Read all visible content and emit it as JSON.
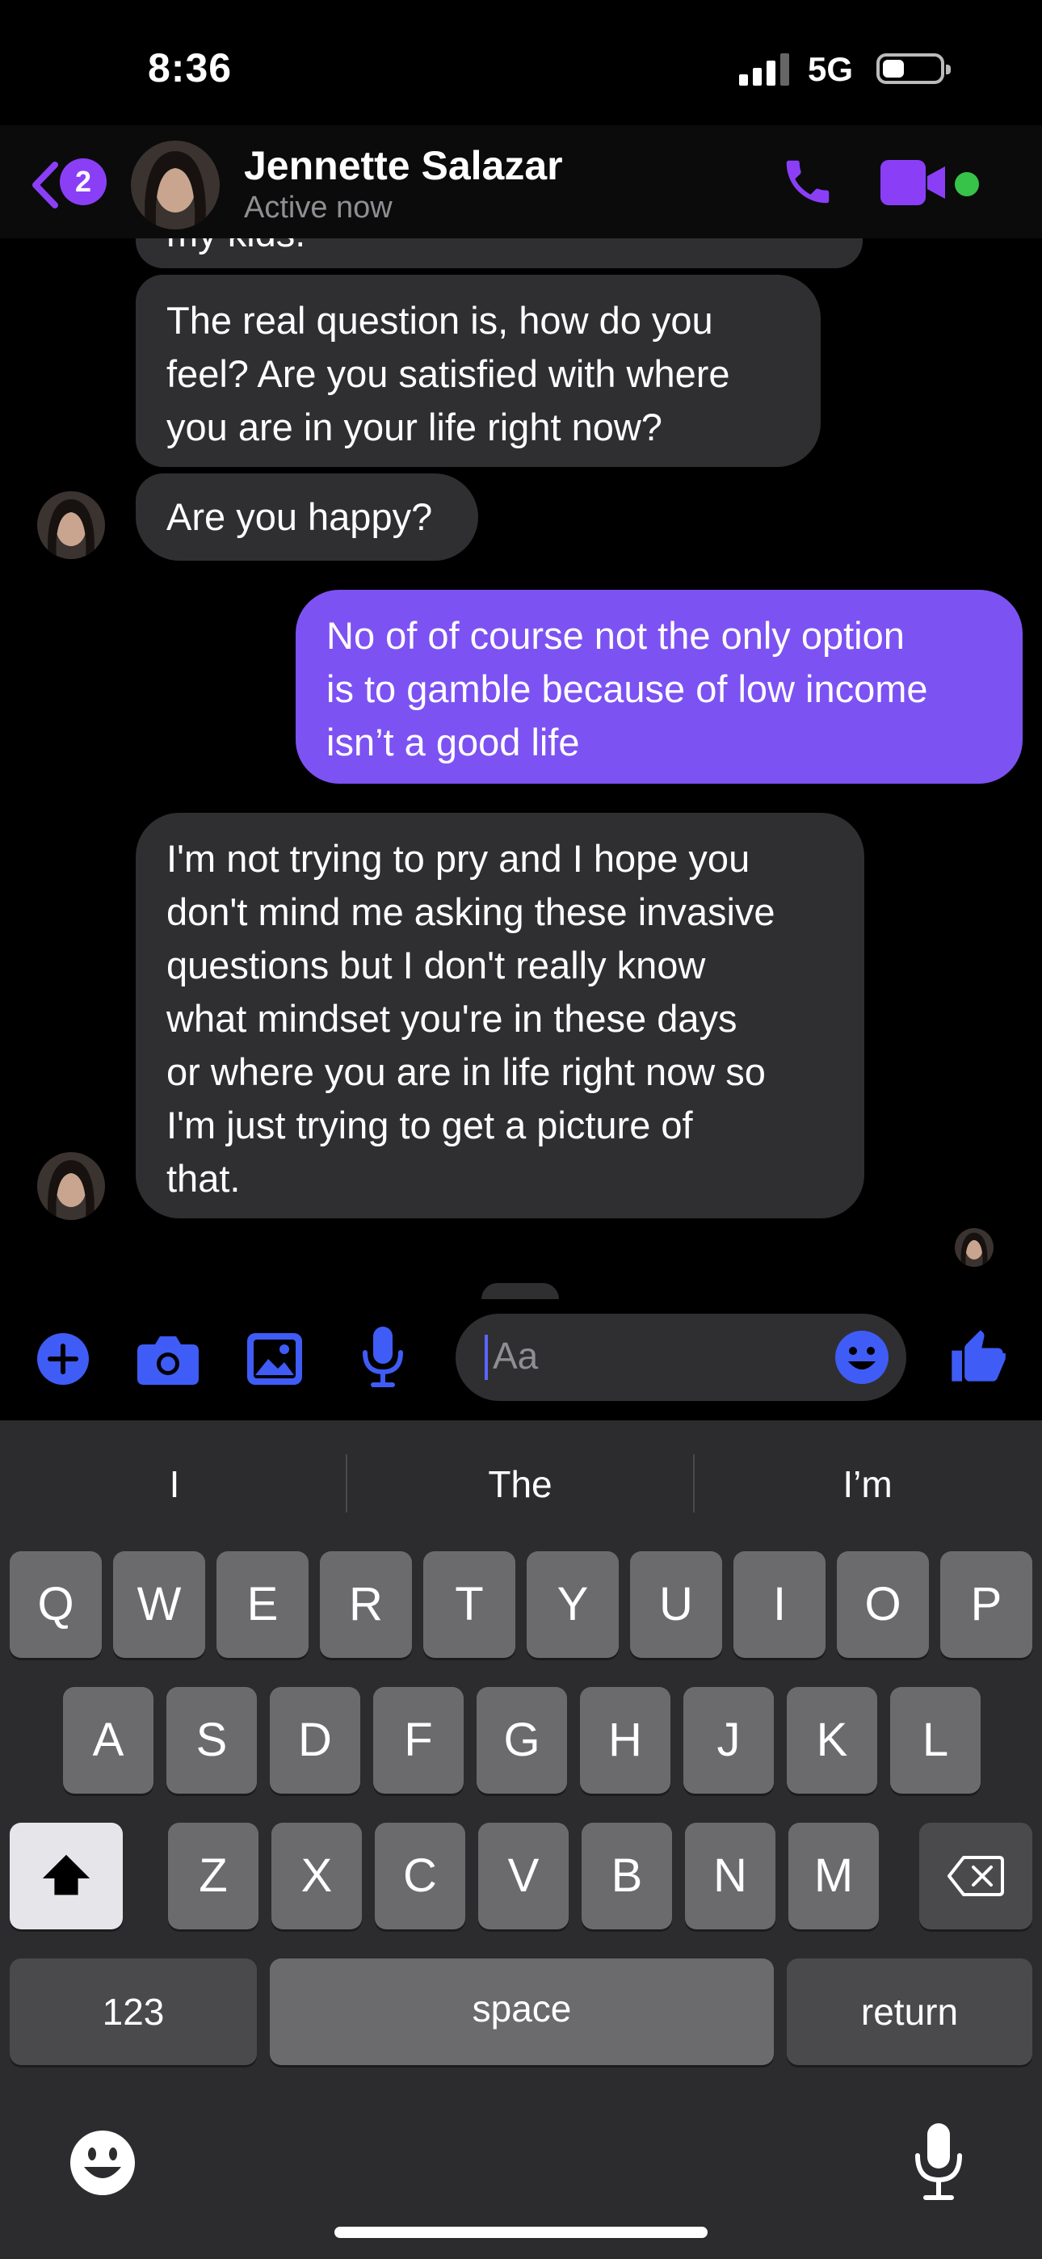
{
  "status_bar": {
    "time": "8:36",
    "network": "5G"
  },
  "header": {
    "unread_count": "2",
    "contact_name": "Jennette Salazar",
    "contact_status": "Active now"
  },
  "messages": {
    "partial_top": "my kids.",
    "m1": [
      "The real question is, how do you",
      "feel? Are you satisfied with where",
      "you are in your life right now?"
    ],
    "m2": "Are you happy?",
    "m3": [
      "No of of course not the only option",
      "is to gamble because of low income",
      "isn’t a good life"
    ],
    "m4": [
      "I'm not trying to pry and I hope you",
      "don't mind me asking these invasive",
      "questions but I don't really know",
      "what mindset you're in these days",
      "or where you are in life right now so",
      "I'm just trying to get a picture of",
      "that."
    ]
  },
  "composer": {
    "placeholder": "Aa"
  },
  "keyboard": {
    "suggestions": [
      "I",
      "The",
      "I’m"
    ],
    "row1": [
      "Q",
      "W",
      "E",
      "R",
      "T",
      "Y",
      "U",
      "I",
      "O",
      "P"
    ],
    "row2": [
      "A",
      "S",
      "D",
      "F",
      "G",
      "H",
      "J",
      "K",
      "L"
    ],
    "row3": [
      "Z",
      "X",
      "C",
      "V",
      "B",
      "N",
      "M"
    ],
    "numbers_label": "123",
    "space_label": "space",
    "return_label": "return"
  },
  "colors": {
    "accent": "#8a3ff7",
    "sent_bubble": "#7d52f3",
    "received_bubble": "#2f2f31",
    "tool_blue": "#3f5cf6",
    "online": "#37c24a"
  },
  "icons": [
    "back-chevron-icon",
    "phone-icon",
    "video-icon",
    "plus-icon",
    "camera-icon",
    "gallery-icon",
    "mic-icon",
    "emoji-icon",
    "thumbs-up-icon",
    "shift-icon",
    "backspace-icon",
    "keyboard-emoji-icon",
    "dictation-mic-icon"
  ]
}
